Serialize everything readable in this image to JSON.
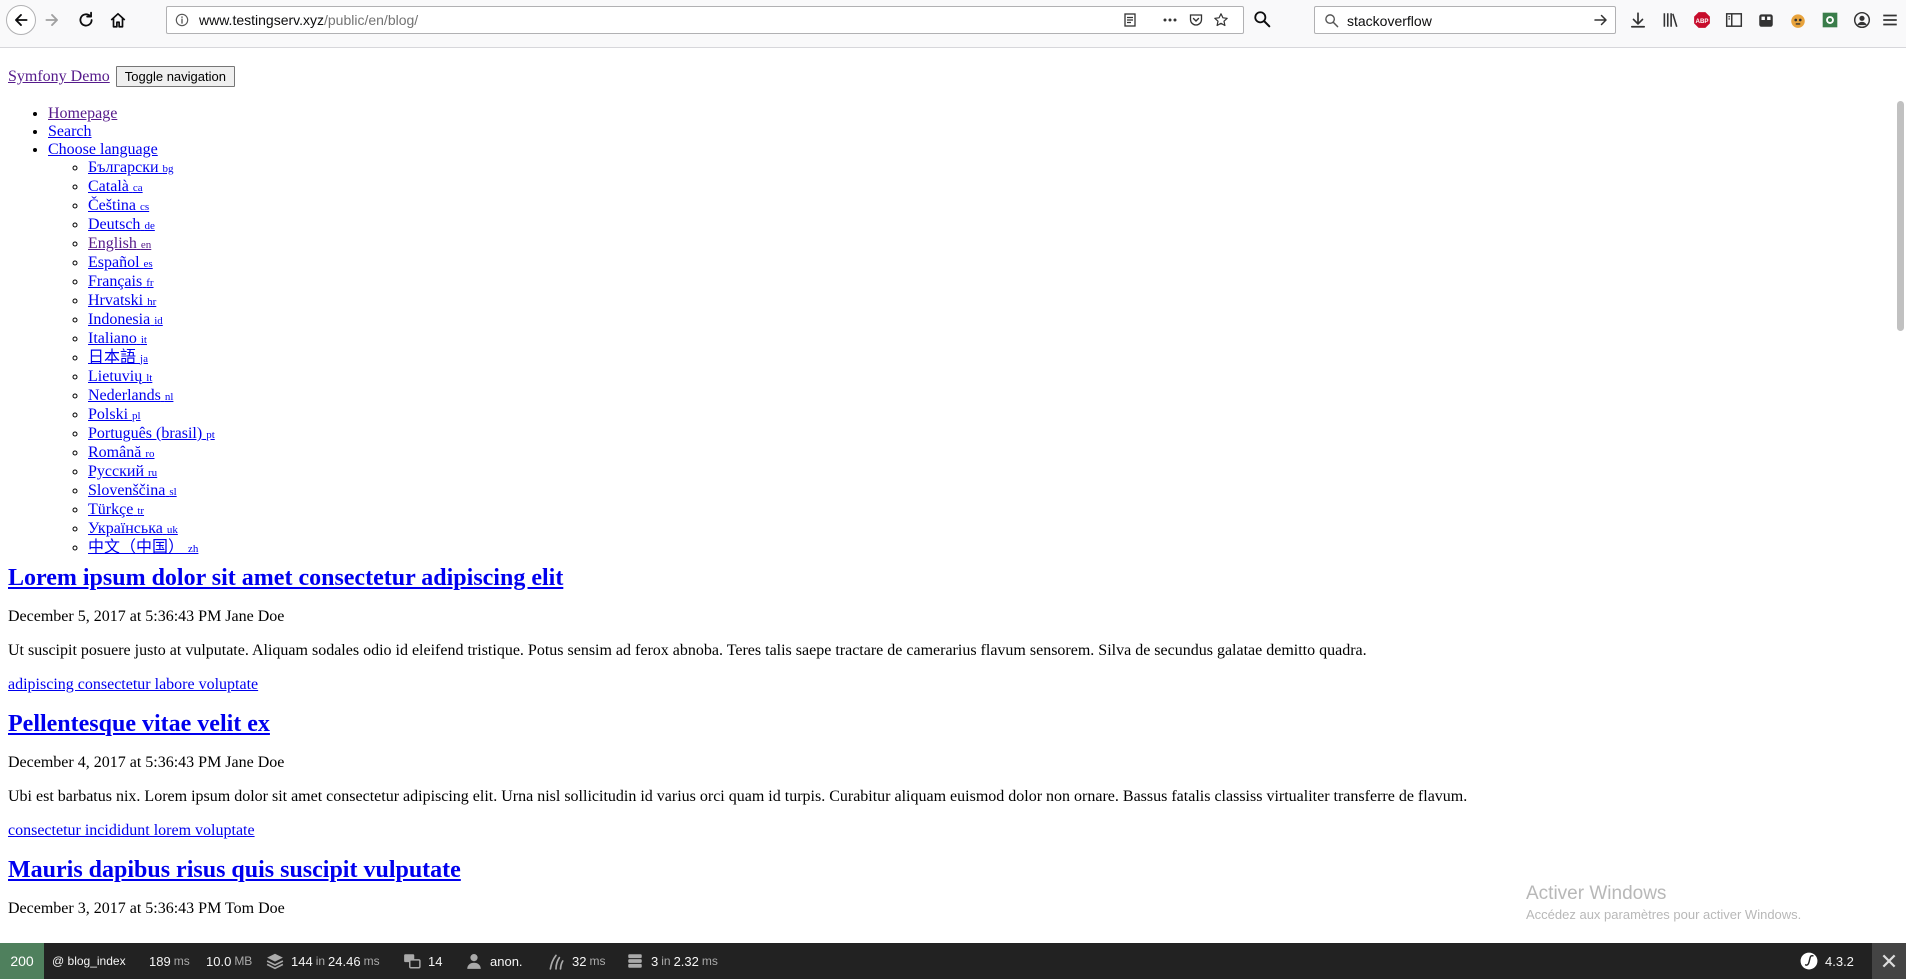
{
  "browser": {
    "url_host": "www.testingserv.xyz",
    "url_path": "/public/en/blog/",
    "search_value": "stackoverflow",
    "addon_abp_label": "ABP"
  },
  "page": {
    "brand": "Symfony Demo",
    "toggle_label": "Toggle navigation",
    "menu": {
      "homepage": "Homepage",
      "search": "Search",
      "choose_language": "Choose language"
    },
    "languages": [
      {
        "name": "Български",
        "code": "bg"
      },
      {
        "name": "Català",
        "code": "ca"
      },
      {
        "name": "Čeština",
        "code": "cs"
      },
      {
        "name": "Deutsch",
        "code": "de"
      },
      {
        "name": "English",
        "code": "en"
      },
      {
        "name": "Español",
        "code": "es"
      },
      {
        "name": "Français",
        "code": "fr"
      },
      {
        "name": "Hrvatski",
        "code": "hr"
      },
      {
        "name": "Indonesia",
        "code": "id"
      },
      {
        "name": "Italiano",
        "code": "it"
      },
      {
        "name": "日本語",
        "code": "ja"
      },
      {
        "name": "Lietuvių",
        "code": "lt"
      },
      {
        "name": "Nederlands",
        "code": "nl"
      },
      {
        "name": "Polski",
        "code": "pl"
      },
      {
        "name": "Português (brasil)",
        "code": "pt"
      },
      {
        "name": "Română",
        "code": "ro"
      },
      {
        "name": "Русский",
        "code": "ru"
      },
      {
        "name": "Slovenščina",
        "code": "sl"
      },
      {
        "name": "Türkçe",
        "code": "tr"
      },
      {
        "name": "Українська",
        "code": "uk"
      },
      {
        "name": "中文（中国）",
        "code": "zh"
      }
    ],
    "posts": [
      {
        "title": "Lorem ipsum dolor sit amet consectetur adipiscing elit",
        "meta": "December 5, 2017 at 5:36:43 PM Jane Doe",
        "summary": "Ut suscipit posuere justo at vulputate. Aliquam sodales odio id eleifend tristique. Potus sensim ad ferox abnoba. Teres talis saepe tractare de camerarius flavum sensorem. Silva de secundus galatae demitto quadra.",
        "tags": "adipiscing consectetur labore voluptate"
      },
      {
        "title": "Pellentesque vitae velit ex",
        "meta": "December 4, 2017 at 5:36:43 PM Jane Doe",
        "summary": "Ubi est barbatus nix. Lorem ipsum dolor sit amet consectetur adipiscing elit. Urna nisl sollicitudin id varius orci quam id turpis. Curabitur aliquam euismod dolor non ornare. Bassus fatalis classiss virtualiter transferre de flavum.",
        "tags": "consectetur incididunt lorem voluptate"
      },
      {
        "title": "Mauris dapibus risus quis suscipit vulputate",
        "meta": "December 3, 2017 at 5:36:43 PM Tom Doe"
      }
    ]
  },
  "watermark": {
    "line1": "Activer Windows",
    "line2": "Accédez aux paramètres pour activer Windows."
  },
  "toolbar": {
    "status": "200",
    "route": "@ blog_index",
    "time": "189",
    "time_unit": "ms",
    "memory": "10.0",
    "memory_unit": "MB",
    "cache_count": "144",
    "cache_in": "in",
    "cache_time": "24.46",
    "cache_unit": "ms",
    "translations": "14",
    "user": "anon.",
    "twig_time": "32",
    "twig_unit": "ms",
    "db_queries": "3",
    "db_in": "in",
    "db_time": "2.32",
    "db_unit": "ms",
    "version": "4.3.2",
    "status_color": "#4f805d"
  }
}
